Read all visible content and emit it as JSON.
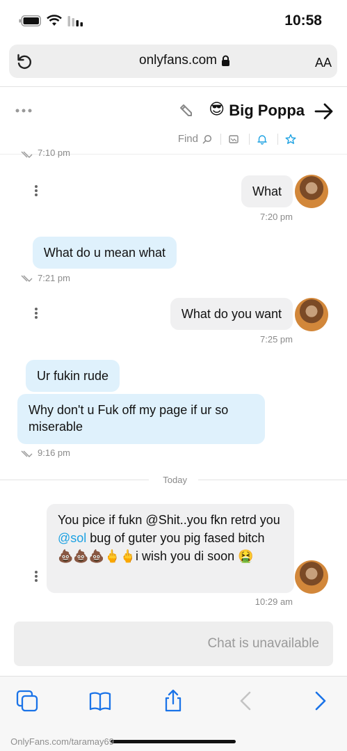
{
  "status_bar": {
    "time": "10:58"
  },
  "browser": {
    "url": "onlyfans.com",
    "text_size_label": "AA"
  },
  "chat_header": {
    "contact_name": "Big Poppa",
    "emoji": "😎",
    "find_label": "Find"
  },
  "conversation": {
    "partial_timestamp": "7:10 pm",
    "messages": [
      {
        "direction": "sent",
        "text": "What",
        "time": "7:20 pm"
      },
      {
        "direction": "received",
        "text": "What do u mean what",
        "time": "7:21 pm"
      },
      {
        "direction": "sent",
        "text": "What do you want",
        "time": "7:25 pm"
      },
      {
        "direction": "received",
        "text": "Ur fukin rude",
        "time": ""
      },
      {
        "direction": "received",
        "text": "Why don't u Fuk off my page if ur so miserable",
        "time": "9:16 pm"
      },
      {
        "direction": "sent",
        "text_parts": [
          "You pice if fukn @Shit..you fkn retrd you ",
          "@sol",
          " bug of guter you pig fased bitch 💩💩💩🖕🖕i wish you di soon 🤮"
        ],
        "time": "10:29 am"
      }
    ],
    "day_separator": "Today"
  },
  "composer": {
    "disabled_text": "Chat is unavailable"
  },
  "watermark": "OnlyFans.com/taramay69"
}
